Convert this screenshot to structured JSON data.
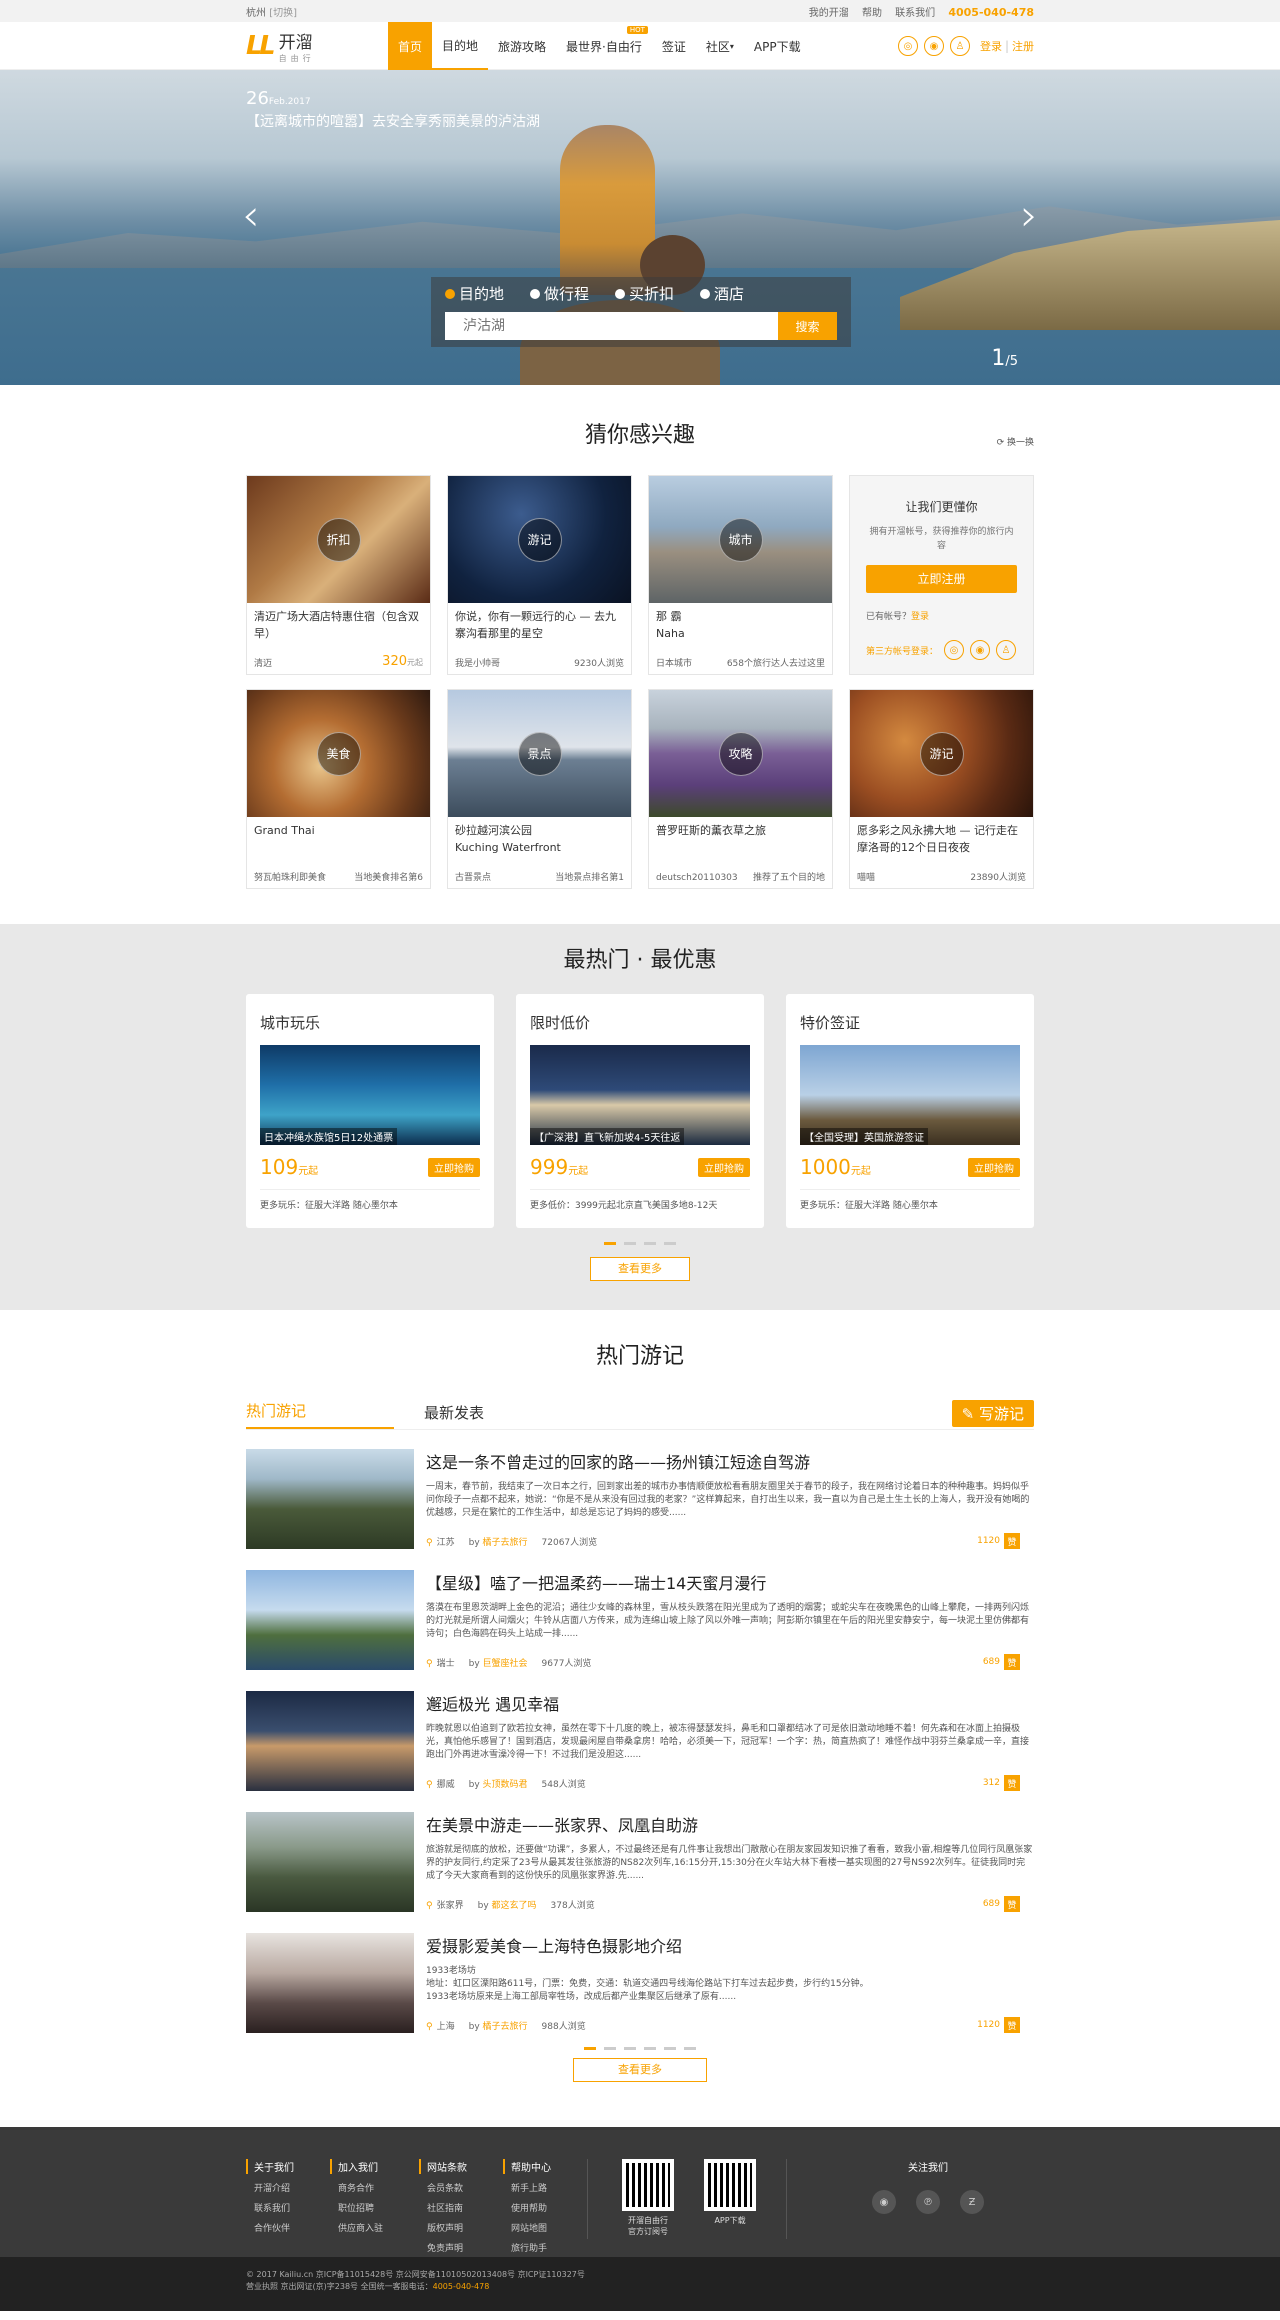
{
  "topbar": {
    "city": "杭州",
    "switch": "[切换]",
    "links": [
      "我的开溜",
      "帮助",
      "联系我们"
    ],
    "phone": "4005-040-478"
  },
  "header": {
    "logo_main": "开溜",
    "logo_sub": "自由行",
    "nav": [
      "首页",
      "目的地",
      "旅游攻略",
      "最世界·自由行",
      "签证",
      "社区",
      "APP下载"
    ],
    "hot_badge": "HOT",
    "login": "登录",
    "register": "注册"
  },
  "hero": {
    "day": "26",
    "month": "Feb.2017",
    "caption": "【远离城市的喧嚣】去安全享秀丽美景的泸沽湖",
    "tabs": [
      "目的地",
      "做行程",
      "买折扣",
      "酒店"
    ],
    "search_placeholder": "泸沽湖",
    "search_button": "搜索",
    "page_current": "1",
    "page_total": "/5"
  },
  "guess": {
    "title": "猜你感兴趣",
    "refresh": "换一换",
    "cards": [
      {
        "badge": "折扣",
        "title": "清迈广场大酒店特惠住宿（包含双早）",
        "left": "清迈",
        "price": "320",
        "unit": "元起"
      },
      {
        "badge": "游记",
        "title": "你说，你有一颗远行的心 — 去九寨沟看那里的星空",
        "left": "我是小帅哥",
        "right": "9230人浏览"
      },
      {
        "badge": "城市",
        "title": "那 霸\nNaha",
        "left": "日本城市",
        "right": "658个旅行达人去过这里"
      },
      {
        "badge": "美食",
        "title": "Grand Thai",
        "left": "努瓦帕珠利即美食",
        "right": "当地美食排名第6"
      },
      {
        "badge": "景点",
        "title": "砂拉越河滨公园\nKuching Waterfront",
        "left": "古晋景点",
        "right": "当地景点排名第1"
      },
      {
        "badge": "攻略",
        "title": "普罗旺斯的薰衣草之旅",
        "left": "deutsch20110303",
        "right": "推荐了五个目的地"
      },
      {
        "badge": "游记",
        "title": "愿多彩之风永拂大地 — 记行走在摩洛哥的12个日日夜夜",
        "left": "喵喵",
        "right": "23890人浏览"
      }
    ],
    "register_card": {
      "title": "让我们更懂你",
      "desc": "拥有开溜帐号，获得推荐你的旅行内容",
      "button": "立即注册",
      "have_account": "已有帐号？",
      "login": "登录",
      "third": "第三方帐号登录："
    }
  },
  "hot": {
    "title": "最热门 · 最优惠",
    "cards": [
      {
        "title": "城市玩乐",
        "caption": "日本冲绳水族馆5日12处通票",
        "price": "109",
        "unit": "元起",
        "buy": "立即抢购",
        "more": "更多玩乐：征服大洋路 随心墨尔本"
      },
      {
        "title": "限时低价",
        "caption": "【广深港】直飞新加坡4-5天往返",
        "price": "999",
        "unit": "元起",
        "buy": "立即抢购",
        "more": "更多低价：3999元起北京直飞美国多地8-12天"
      },
      {
        "title": "特价签证",
        "caption": "【全国受理】英国旅游签证",
        "price": "1000",
        "unit": "元起",
        "buy": "立即抢购",
        "more": "更多玩乐：征服大洋路 随心墨尔本"
      }
    ],
    "more": "查看更多"
  },
  "notes": {
    "title": "热门游记",
    "tab_hot": "热门游记",
    "tab_new": "最新发表",
    "write": "写游记",
    "posts": [
      {
        "title": "这是一条不曾走过的回家的路——扬州镇江短途自驾游",
        "desc": "一周末，春节前，我结束了一次日本之行，回到家出差的城市办事情顺便放松看看朋友圈里关于春节的段子，我在网络讨论着日本的种种趣事。妈妈似乎问你段子一点都不起来，她说：“你是不是从来没有回过我的老家？”这样算起来，自打出生以来，我一直以为自己是土生土长的上海人，我开没有她喝的优越感，只是在繁忙的工作生活中，却总是忘记了妈妈的感受......",
        "loc": "江苏",
        "author": "橘子去旅行",
        "views": "72067人浏览",
        "likes": "1120",
        "zan": "赞"
      },
      {
        "title": "【星级】嗑了一把温柔药——瑞士14天蜜月漫行",
        "desc": "落漠在布里恩茨湖畔上金色的泥沿；通往少女峰的森林里，雪从枝头跌落在阳光里成为了透明的烟雾；或蛇尖车在夜晚黑色的山峰上攀爬，一排两列闪烁的灯光就是所谓人间烟火；牛铃从店面八方传来，成为连绵山坡上除了风以外唯一声响；阿彭斯尔镇里在午后的阳光里安静安宁，每一块泥土里仿佛都有诗句；白色海鸥在码头上站成一排......",
        "loc": "瑞士",
        "author": "巨蟹座社会",
        "views": "9677人浏览",
        "likes": "689",
        "zan": "赞"
      },
      {
        "title": "邂逅极光 遇见幸福",
        "desc": "昨晚就恩以伯追到了欧若拉女神，虽然在零下十几度的晚上，被冻得瑟瑟发抖，鼻毛和口罩都结冰了可是依旧激动地睡不着！何先森和在冰面上拍摄极光，真怕他乐感冒了！国到酒店，发现最闲屋自带桑拿房！哈哈，必须美一下，冠冠军！一个字：热，简直热疯了！难怪作战中羽芬兰桑拿成一辛，直接跑出门外再进冰雪澡冷得一下！不过我们是没胆这......",
        "loc": "挪威",
        "author": "头顶数码君",
        "views": "548人浏览",
        "likes": "312",
        "zan": "赞"
      },
      {
        "title": "在美景中游走——张家界、凤凰自助游",
        "desc": "旅游就是彻底的放松，还要做“功课”，多累人，不过最终还是有几件事让我想出门散散心在朋友家园发知识推了看看，致我小雷,相煌等几位同行凤凰张家界的护友同行,约定采了23号从最其发往张旅游的NS82次列车,16:15分开,15:30分在火车站大林下看楼一基实现图的27号NS92次列车。征徒我同时完成了今天大家商看到的这份快乐的凤凰张家界游.先......",
        "loc": "张家界",
        "author": "都这玄了吗",
        "views": "378人浏览",
        "likes": "689",
        "zan": "赞"
      },
      {
        "title": "爱摄影爱美食—上海特色摄影地介绍",
        "desc": "1933老场坊\n地址：虹口区溧阳路611号，门票：免费，交通：轨道交通四号线海伦路站下打车过去起步费，步行约15分钟。\n1933老场坊原来是上海工部局宰牲场，改成后都产业集聚区后继承了原有......",
        "loc": "上海",
        "author": "橘子去旅行",
        "views": "988人浏览",
        "likes": "1120",
        "zan": "赞"
      }
    ],
    "more": "查看更多"
  },
  "footer": {
    "cols": [
      {
        "title": "关于我们",
        "items": [
          "开溜介绍",
          "联系我们",
          "合作伙伴"
        ]
      },
      {
        "title": "加入我们",
        "items": [
          "商务合作",
          "职位招聘",
          "供应商入驻"
        ]
      },
      {
        "title": "网站条款",
        "items": [
          "会员条款",
          "社区指南",
          "版权声明",
          "免责声明"
        ]
      },
      {
        "title": "帮助中心",
        "items": [
          "新手上路",
          "使用帮助",
          "网站地图",
          "旅行助手"
        ]
      }
    ],
    "qr1": "开溜自由行\n官方订阅号",
    "qr2": "APP下载",
    "follow": "关注我们",
    "copy1": "© 2017 Kailiu.cn 京ICP备11015428号 京公网安备11010502013408号 京ICP证110327号",
    "copy2_prefix": "营业执照 京出网证(京)字238号 全国统一客服电话：",
    "copy2_phone": "4005-040-478"
  },
  "colors": {
    "accent": "#f8a200",
    "footer": "#3a3a3a"
  }
}
